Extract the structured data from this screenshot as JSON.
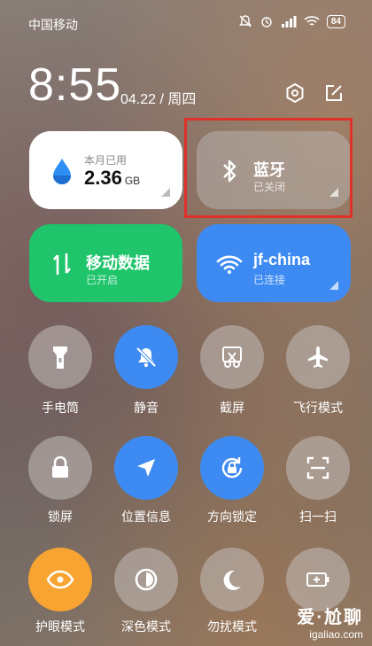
{
  "status_bar": {
    "carrier": "中国移动",
    "battery": "84"
  },
  "clock": {
    "time": "8:55",
    "date": "04.22 / 周四"
  },
  "tiles": {
    "data_usage": {
      "label": "本月已用",
      "value": "2.36",
      "unit": "GB"
    },
    "bluetooth": {
      "title": "蓝牙",
      "status": "已关闭"
    },
    "mobile_data": {
      "title": "移动数据",
      "status": "已开启"
    },
    "wifi": {
      "title": "jf-china",
      "status": "已连接"
    }
  },
  "toggles": [
    {
      "label": "手电筒"
    },
    {
      "label": "静音"
    },
    {
      "label": "截屏"
    },
    {
      "label": "飞行模式"
    },
    {
      "label": "锁屏"
    },
    {
      "label": "位置信息"
    },
    {
      "label": "方向锁定"
    },
    {
      "label": "扫一扫"
    },
    {
      "label": "护眼模式"
    },
    {
      "label": "深色模式"
    },
    {
      "label": "勿扰模式"
    },
    {
      "label": ""
    }
  ],
  "watermark": {
    "title": "爱·尬聊",
    "url": "igaliao.com"
  },
  "colors": {
    "blue": "#3d8bf2",
    "green": "#1fc46b",
    "orange": "#f7a432",
    "highlight": "#e0302a"
  }
}
